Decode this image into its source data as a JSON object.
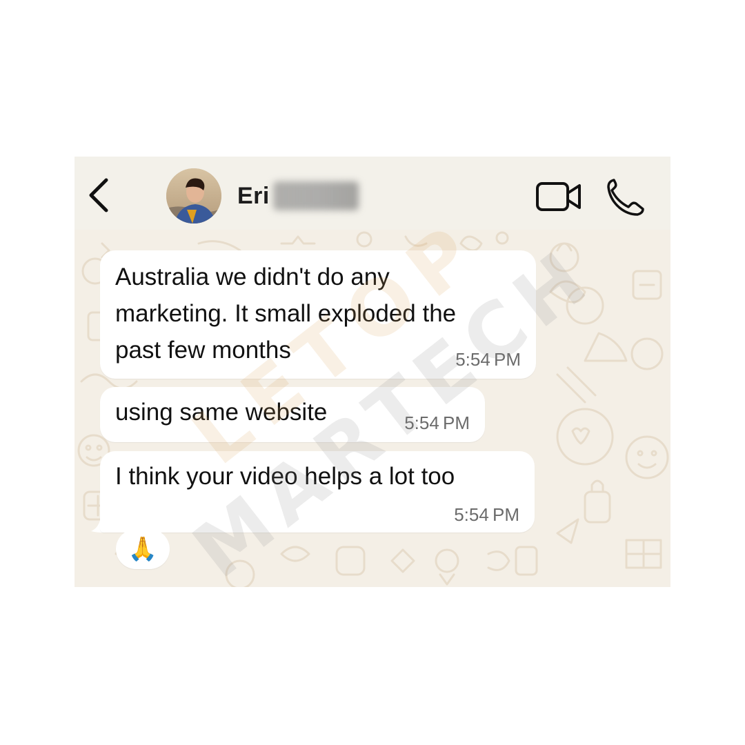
{
  "header": {
    "contact_name": "Eric K…g",
    "contact_name_visible": "Eri"
  },
  "icons": {
    "back": "chevron-left-icon",
    "video": "video-camera-icon",
    "call": "phone-icon"
  },
  "messages": [
    {
      "text": "Australia we didn't do any\nmarketing. It small exploded the\npast few months",
      "time": "5:54 PM"
    },
    {
      "text": "using same website",
      "time": "5:54 PM"
    },
    {
      "text": "I think your video helps a lot too",
      "time": "5:54 PM"
    }
  ],
  "reaction": {
    "emoji": "🙏"
  },
  "watermark": {
    "line1": "LETOP",
    "line2": "MARTECH"
  },
  "colors": {
    "header_bg": "#f3f1ea",
    "chat_bg": "#f4efe6",
    "bubble_bg": "#ffffff",
    "text": "#111111",
    "timestamp": "#6b6b6b"
  }
}
